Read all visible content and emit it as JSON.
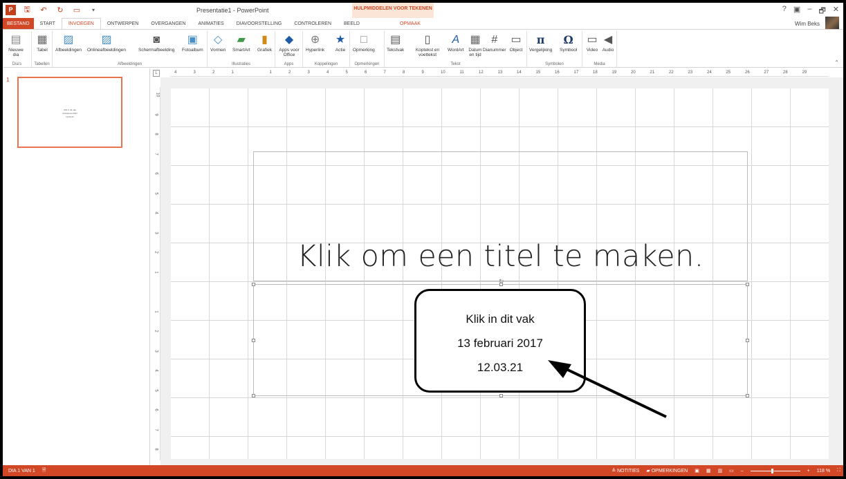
{
  "window": {
    "title": "Presentatie1 - PowerPoint",
    "contextual_group": "HULPMIDDELEN VOOR TEKENEN",
    "user_name": "Wim Beks",
    "controls": [
      "?",
      "▣",
      "–",
      "🗗",
      "✕"
    ]
  },
  "tabs": [
    {
      "label": "BESTAND"
    },
    {
      "label": "START"
    },
    {
      "label": "INVOEGEN"
    },
    {
      "label": "ONTWERPEN"
    },
    {
      "label": "OVERGANGEN"
    },
    {
      "label": "ANIMATIES"
    },
    {
      "label": "DIAVOORSTELLING"
    },
    {
      "label": "CONTROLEREN"
    },
    {
      "label": "BEELD"
    },
    {
      "label": "OPMAAK"
    }
  ],
  "ribbon": {
    "groups": {
      "dias": "Dia's",
      "tabellen": "Tabellen",
      "afbeeldingen": "Afbeeldingen",
      "illustraties": "Illustraties",
      "apps": "Apps",
      "koppelingen": "Koppelingen",
      "opmerkingen": "Opmerkingen",
      "tekst": "Tekst",
      "symbolen": "Symbolen",
      "media": "Media"
    },
    "buttons": {
      "nieuwe_dia": "Nieuwe dia",
      "tabel": "Tabel",
      "afbeeldingen": "Afbeeldingen",
      "onlineafbeeldingen": "Onlineafbeeldingen",
      "schermafbeelding": "Schermafbeelding",
      "fotoalbum": "Fotoalbum",
      "vormen": "Vormen",
      "smartart": "SmartArt",
      "grafiek": "Grafiek",
      "apps_voor_office": "Apps voor Office",
      "hyperlink": "Hyperlink",
      "actie": "Actie",
      "opmerking": "Opmerking",
      "tekstvak": "Tekstvak",
      "koptekst": "Koptekst en voettekst",
      "wordart": "WordArt",
      "datum": "Datum en tijd",
      "dianummer": "Dianummer",
      "object": "Object",
      "vergelijking": "Vergelijking",
      "symbool": "Symbool",
      "video": "Video",
      "audio": "Audio"
    }
  },
  "thumbnail": {
    "number": "1",
    "line1": "Klik in dit vak",
    "line2": "13 februari 2017",
    "line3": "12.03.21"
  },
  "slide": {
    "title_placeholder": "Klik om een titel te maken.",
    "callout_line1": "Klik in dit vak",
    "callout_line2": "13 februari 2017",
    "callout_line3": "12.03.21"
  },
  "statusbar": {
    "slide_indicator": "DIA 1 VAN 1",
    "notes": "NOTITIES",
    "comments": "OPMERKINGEN",
    "zoom": "118 %"
  },
  "colors": {
    "accent": "#d24726",
    "thumbnail_border": "#e8744f"
  }
}
